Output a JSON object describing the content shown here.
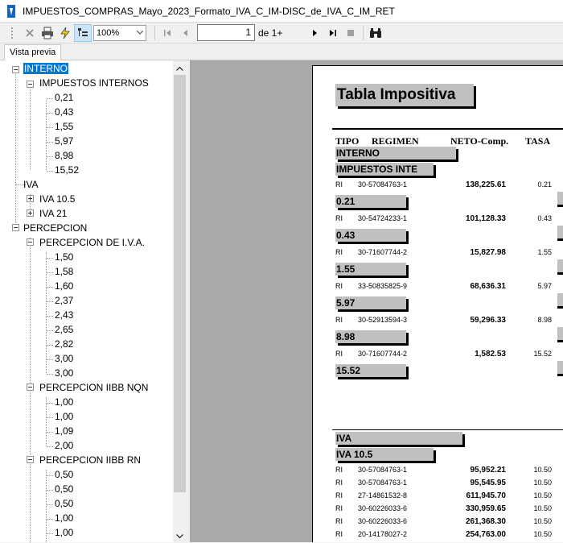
{
  "window": {
    "title": "IMPUESTOS_COMPRAS_Mayo_2023_Formato_IVA_C_IM-DISC_de_IVA_C_IM_RET"
  },
  "toolbar": {
    "zoom": "100%",
    "page_number": "1",
    "page_of": "de 1+"
  },
  "tabs": [
    {
      "label": "Vista previa"
    }
  ],
  "tree": {
    "interno": "INTERNO",
    "impuestos_internos": "IMPUESTOS INTERNOS",
    "internos_leaves": [
      "0,21",
      "0,43",
      "1,55",
      "5,97",
      "8,98",
      "15,52"
    ],
    "iva": "IVA",
    "iva_children": [
      "IVA 10.5",
      "IVA 21"
    ],
    "percepcion": "PERCEPCION",
    "perc_iva": "PERCEPCION DE I.V.A.",
    "perc_iva_leaves": [
      "1,50",
      "1,58",
      "1,60",
      "2,37",
      "2,43",
      "2,65",
      "2,82",
      "3,00",
      "3,00"
    ],
    "perc_nqn": "PERCEPCION IIBB NQN",
    "perc_nqn_leaves": [
      "1,00",
      "1,00",
      "1,09",
      "2,00"
    ],
    "perc_rn": "PERCEPCION IIBB RN",
    "perc_rn_leaves": [
      "0,50",
      "0,50",
      "0,50",
      "1,00",
      "1,00"
    ]
  },
  "report": {
    "title": "Tabla Impositiva",
    "headers": {
      "tipo": "TIPO",
      "regimen": "REGIMEN",
      "neto": "NETO-Comp.",
      "tasa": "TASA"
    },
    "group_interno": "INTERNO",
    "subgroup_internos": "IMPUESTOS INTE",
    "internos_rows": [
      {
        "tipo": "RI",
        "cuit": "30-57084763-1",
        "neto": "138,225.61",
        "tasa": "0.21",
        "band": "0.21"
      },
      {
        "tipo": "RI",
        "cuit": "30-54724233-1",
        "neto": "101,128.33",
        "tasa": "0.43",
        "band": "0.43"
      },
      {
        "tipo": "RI",
        "cuit": "30-71607744-2",
        "neto": "15,827.98",
        "tasa": "1.55",
        "band": "1.55"
      },
      {
        "tipo": "RI",
        "cuit": "33-50835825-9",
        "neto": "68,636.31",
        "tasa": "5.97",
        "band": "5.97"
      },
      {
        "tipo": "RI",
        "cuit": "30-52913594-3",
        "neto": "59,296.33",
        "tasa": "8.98",
        "band": "8.98"
      },
      {
        "tipo": "RI",
        "cuit": "30-71607744-2",
        "neto": "1,582.53",
        "tasa": "15.52",
        "band": "15.52"
      }
    ],
    "group_iva": "IVA",
    "subgroup_iva105": "IVA 10.5",
    "iva_rows": [
      {
        "tipo": "RI",
        "cuit": "30-57084763-1",
        "neto": "95,952.21",
        "tasa": "10.50"
      },
      {
        "tipo": "RI",
        "cuit": "30-57084763-1",
        "neto": "95,545.95",
        "tasa": "10.50"
      },
      {
        "tipo": "RI",
        "cuit": "27-14861532-8",
        "neto": "611,945.70",
        "tasa": "10.50"
      },
      {
        "tipo": "RI",
        "cuit": "30-60226033-6",
        "neto": "330,959.65",
        "tasa": "10.50"
      },
      {
        "tipo": "RI",
        "cuit": "30-60226033-6",
        "neto": "261,368.30",
        "tasa": "10.50"
      },
      {
        "tipo": "RI",
        "cuit": "20-14178027-2",
        "neto": "254,763.00",
        "tasa": "10.50"
      }
    ]
  },
  "colors": {
    "selection": "#0078d7",
    "band_gray": "#c0c0c0",
    "viewer_bg": "#a9a9a9"
  }
}
